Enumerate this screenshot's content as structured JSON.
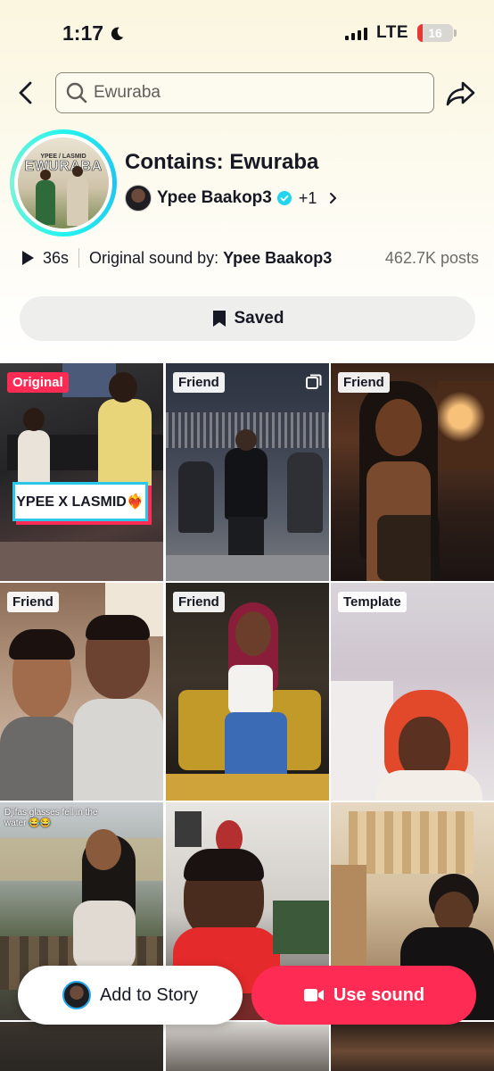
{
  "status_bar": {
    "time": "1:17",
    "network": "LTE",
    "battery": "16",
    "battery_fraction": 0.16
  },
  "search": {
    "value": "Ewuraba",
    "placeholder": "Ewuraba"
  },
  "sound": {
    "cover_small_text": "YPEE / LASMID",
    "cover_title": "EWURABA",
    "title": "Contains: Ewuraba",
    "artist": "Ypee Baakop3",
    "extra_artists": "+1",
    "duration": "36s",
    "original_prefix": "Original sound by:",
    "original_artist": "Ypee Baakop3",
    "posts": "462.7K posts"
  },
  "saved_label": "Saved",
  "grid": {
    "items": [
      {
        "badge": "Original",
        "overlay": "YPEE X LASMID❤️‍🔥"
      },
      {
        "badge": "Friend"
      },
      {
        "badge": "Friend"
      },
      {
        "badge": "Friend"
      },
      {
        "badge": "Friend"
      },
      {
        "badge": "Template"
      },
      {
        "caption": "Djifas glasses fell in the water 😂😂"
      },
      {},
      {}
    ]
  },
  "actions": {
    "add_to_story": "Add to Story",
    "use_sound": "Use sound"
  },
  "colors": {
    "accent": "#fe2c55",
    "ring": "#25f4ee",
    "badge_original": "#fe2c55"
  }
}
